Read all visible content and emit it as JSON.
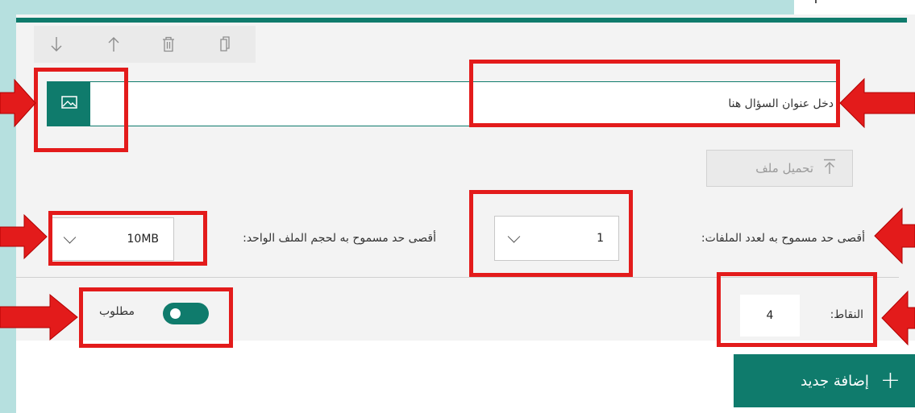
{
  "toolbar": {
    "move_down_icon": "arrow-down-icon",
    "move_up_icon": "arrow-up-icon",
    "delete_icon": "trash-icon",
    "copy_icon": "copy-icon"
  },
  "question": {
    "title_placeholder": "دخل عنوان السؤال هنا",
    "insert_image_icon": "image-icon"
  },
  "upload": {
    "label": "تحميل ملف"
  },
  "file_count": {
    "label": "أقصى حد مسموح به لعدد الملفات:",
    "value": "1"
  },
  "file_size": {
    "label": "أقصى حد مسموح به لحجم الملف الواحد:",
    "value": "10MB"
  },
  "points": {
    "label": "النقاط:",
    "value": "4"
  },
  "required": {
    "label": "مطلوب",
    "checked": true
  },
  "add_new": {
    "label": "إضافة جديد"
  },
  "colors": {
    "accent": "#0f7b6c",
    "annotation": "#e31b1b",
    "frame": "#b6e0df"
  }
}
